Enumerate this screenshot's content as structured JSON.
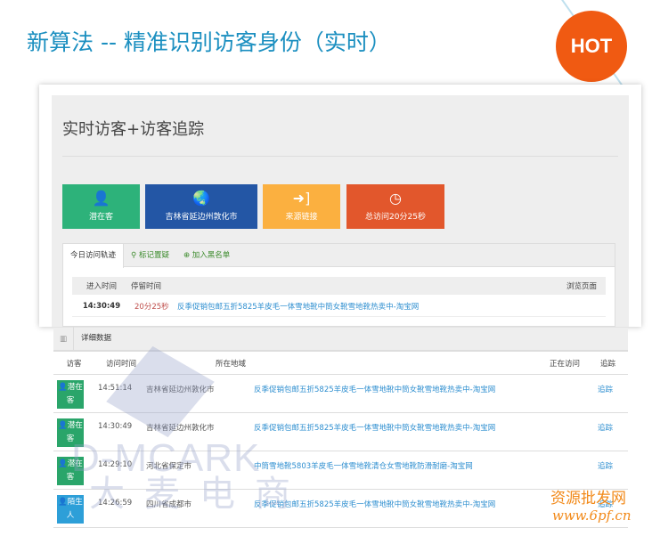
{
  "page_title": "新算法 -- 精准识别访客身份（实时）",
  "hot_badge": "HOT",
  "panel": {
    "title": "实时访客+访客追踪",
    "cards": [
      {
        "icon": "user-icon",
        "label": "潜在客",
        "color": "#2db27a"
      },
      {
        "icon": "globe-icon",
        "label": "吉林省延边州敦化市",
        "color": "#2356a5"
      },
      {
        "icon": "sign-in-icon",
        "label": "来源链接",
        "color": "#fbb040"
      },
      {
        "icon": "clock-icon",
        "label": "总访问20分25秒",
        "color": "#e2572c"
      }
    ],
    "tabs": [
      {
        "label": "今日访问轨迹",
        "icon": ""
      },
      {
        "label": "标记置疑",
        "icon": "map-marker-icon"
      },
      {
        "label": "加入黑名单",
        "icon": "plus-circle-icon"
      }
    ],
    "columns": [
      "进入时间",
      "停留时间",
      "浏览页面"
    ],
    "rows": [
      {
        "time": "14:30:49",
        "stay": "20分25秒",
        "page": "反季促销包邮五折5825羊皮毛一体雪地靴中筒女靴雪地靴热卖中-淘宝网"
      }
    ]
  },
  "details": {
    "header": "详细数据",
    "columns": [
      "访客",
      "访问时间",
      "所在地域",
      "正在访问",
      "追踪"
    ],
    "rows": [
      {
        "badge": "潜在客",
        "badge_color": "#2aa56a",
        "time": "14:51:14",
        "region": "吉林省延边州敦化市",
        "page": "反季促销包邮五折5825羊皮毛一体雪地靴中筒女靴雪地靴热卖中-淘宝网",
        "track": "追踪"
      },
      {
        "badge": "潜在客",
        "badge_color": "#2aa56a",
        "time": "14:30:49",
        "region": "吉林省延边州敦化市",
        "page": "反季促销包邮五折5825羊皮毛一体雪地靴中筒女靴雪地靴热卖中-淘宝网",
        "track": "追踪"
      },
      {
        "badge": "潜在客",
        "badge_color": "#2aa56a",
        "time": "14:29:10",
        "region": "河北省保定市",
        "page": "中筒雪地靴5803羊皮毛一体雪地靴清仓女雪地靴防滑耐磨-淘宝网",
        "track": "追踪"
      },
      {
        "badge": "陌生人",
        "badge_color": "#2d9fd8",
        "time": "14:26:59",
        "region": "四川省成都市",
        "page": "反季促销包邮五折5825羊皮毛一体雪地靴中筒女靴雪地靴热卖中-淘宝网",
        "track": "追踪"
      }
    ]
  },
  "watermarks": {
    "brand_en": "D-MCARK",
    "brand_cn": "大麦电商",
    "site_cn": "资源批发网",
    "site_url": "www.6pf.cn"
  }
}
